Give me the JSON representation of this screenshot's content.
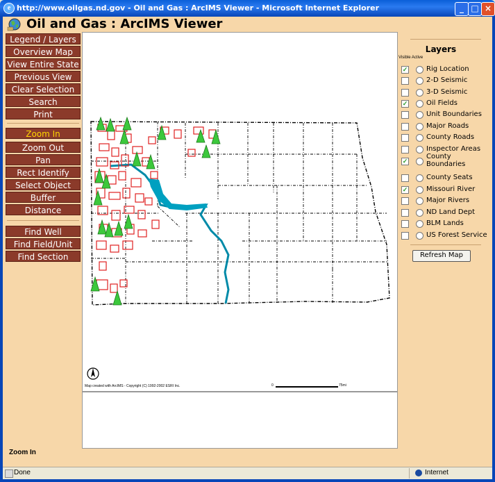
{
  "window": {
    "title": "http://www.oilgas.nd.gov - Oil and Gas : ArcIMS Viewer - Microsoft Internet Explorer",
    "ie_icon_glyph": "e",
    "minimize_glyph": "_",
    "maximize_glyph": "□",
    "close_glyph": "×"
  },
  "app": {
    "title": "Oil and Gas : ArcIMS Viewer"
  },
  "toolbar": {
    "nav_buttons": [
      "Legend / Layers",
      "Overview Map",
      "View Entire State",
      "Previous View",
      "Clear Selection",
      "Search",
      "Print"
    ],
    "tool_buttons": [
      "Zoom In",
      "Zoom Out",
      "Pan",
      "Rect Identify",
      "Select Object",
      "Buffer",
      "Distance"
    ],
    "find_buttons": [
      "Find Well",
      "Find Field/Unit",
      "Find Section"
    ],
    "active_tool": "Zoom In"
  },
  "map": {
    "credit": "Map created with ArcIMS - Copyright (C) 1992-2002 ESRI Inc.",
    "scale_start": "0",
    "scale_end": "75mi"
  },
  "layers": {
    "title": "Layers",
    "column_header": "Visible Active",
    "items": [
      {
        "name": "Rig Location",
        "visible": true
      },
      {
        "name": "2-D Seismic",
        "visible": false
      },
      {
        "name": "3-D Seismic",
        "visible": false
      },
      {
        "name": "Oil Fields",
        "visible": true
      },
      {
        "name": "Unit Boundaries",
        "visible": false
      },
      {
        "name": "Major Roads",
        "visible": false
      },
      {
        "name": "County Roads",
        "visible": false
      },
      {
        "name": "Inspector Areas",
        "visible": false
      },
      {
        "name": "County Boundaries",
        "visible": true
      },
      {
        "name": "County Seats",
        "visible": false
      },
      {
        "name": "Missouri River",
        "visible": true
      },
      {
        "name": "Major Rivers",
        "visible": false
      },
      {
        "name": "ND Land Dept",
        "visible": false
      },
      {
        "name": "BLM Lands",
        "visible": false
      },
      {
        "name": "US Forest Service",
        "visible": false
      }
    ],
    "check_glyph": "✓",
    "refresh_label": "Refresh Map"
  },
  "mode_status": "Zoom In",
  "statusbar": {
    "text": "Done",
    "zone": "Internet"
  },
  "colors": {
    "panel_bg": "#f7d7a9",
    "button_bg": "#8b3a2a",
    "active_text": "#ffd700",
    "oil_field": "#e02020",
    "river": "#00a0c0",
    "rig": "#3cc83c"
  }
}
